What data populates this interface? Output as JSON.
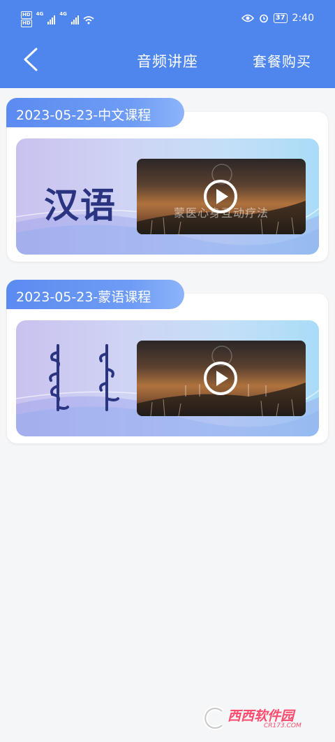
{
  "status_bar": {
    "hd1": "HD",
    "hd2": "HD",
    "net1": "4G",
    "net2": "4G",
    "battery": "37",
    "time": "2:40"
  },
  "header": {
    "title": "音频讲座",
    "action": "套餐购买"
  },
  "courses": [
    {
      "date": "2023-05-23-中文课程",
      "language_label": "汉语",
      "thumbnail_caption": "蒙医心身互动疗法"
    },
    {
      "date": "2023-05-23-蒙语课程",
      "language_label": "",
      "thumbnail_caption": ""
    }
  ],
  "watermark": {
    "text": "西西软件园",
    "sub": "CR173.COM"
  },
  "colors": {
    "header": "#4f86ee",
    "tab": "#5b8bf0",
    "lang_text": "#2b3480"
  }
}
